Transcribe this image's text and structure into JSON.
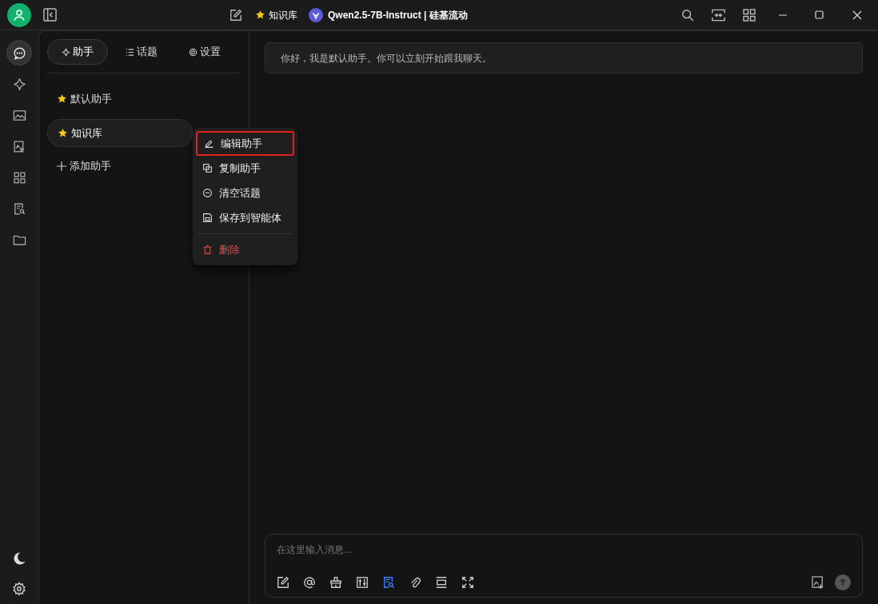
{
  "titlebar": {
    "assistant": "知识库",
    "model": "Qwen2.5-7B-Instruct | 硅基流动"
  },
  "rail_items": [
    {
      "selected": true
    },
    {
      "selected": false
    },
    {
      "selected": false
    },
    {
      "selected": false
    },
    {
      "selected": false
    },
    {
      "selected": false
    },
    {
      "selected": false
    }
  ],
  "tabs": [
    {
      "label": "助手",
      "selected": true
    },
    {
      "label": "话题",
      "selected": false
    },
    {
      "label": "设置",
      "selected": false
    }
  ],
  "assistants": [
    {
      "name": "默认助手",
      "selected": false
    },
    {
      "name": "知识库",
      "selected": true
    }
  ],
  "add_assistant": "添加助手",
  "context_menu": [
    {
      "label": "编辑助手",
      "kind": "normal",
      "highlighted": true
    },
    {
      "label": "复制助手",
      "kind": "normal",
      "highlighted": false
    },
    {
      "label": "清空话题",
      "kind": "normal",
      "highlighted": false
    },
    {
      "label": "保存到智能体",
      "kind": "normal",
      "highlighted": false
    },
    {
      "label": "删除",
      "kind": "danger",
      "highlighted": false
    }
  ],
  "greeting": "你好，我是默认助手。你可以立刻开始跟我聊天。",
  "input": {
    "placeholder": "在这里输入消息..."
  },
  "input_tools": [
    {
      "active": false
    },
    {
      "active": false
    },
    {
      "active": false
    },
    {
      "active": false
    },
    {
      "active": true
    },
    {
      "active": false
    },
    {
      "active": false
    },
    {
      "active": false
    }
  ]
}
